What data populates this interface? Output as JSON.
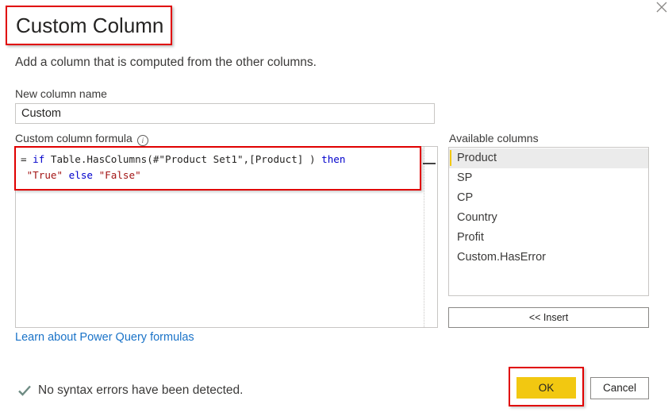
{
  "dialog": {
    "title": "Custom Column",
    "subtitle": "Add a column that is computed from the other columns.",
    "close_icon": "close-icon"
  },
  "new_column": {
    "label": "New column name",
    "value": "Custom"
  },
  "formula": {
    "label": "Custom column formula",
    "info_icon": "info-icon",
    "line1": {
      "prefix": "= ",
      "kw_if": "if",
      "body": " Table.HasColumns(#\"Product Set1\",[Product] ) ",
      "kw_then": "then"
    },
    "line2": {
      "indent": " ",
      "str_true": "\"True\"",
      "kw_else": " else ",
      "str_false": "\"False\""
    }
  },
  "available_columns": {
    "label": "Available columns",
    "items": [
      {
        "label": "Product",
        "selected": true
      },
      {
        "label": "SP"
      },
      {
        "label": "CP"
      },
      {
        "label": "Country"
      },
      {
        "label": "Profit"
      },
      {
        "label": "Custom.HasError"
      }
    ],
    "insert_label": "<< Insert"
  },
  "learn_link": "Learn about Power Query formulas",
  "status": {
    "icon": "checkmark-icon",
    "text": "No syntax errors have been detected."
  },
  "buttons": {
    "ok": "OK",
    "cancel": "Cancel"
  },
  "colors": {
    "accent": "#f2c811",
    "highlight_border": "#e00000",
    "link": "#1a73c8",
    "keyword": "#0000cc",
    "string": "#a31515"
  }
}
